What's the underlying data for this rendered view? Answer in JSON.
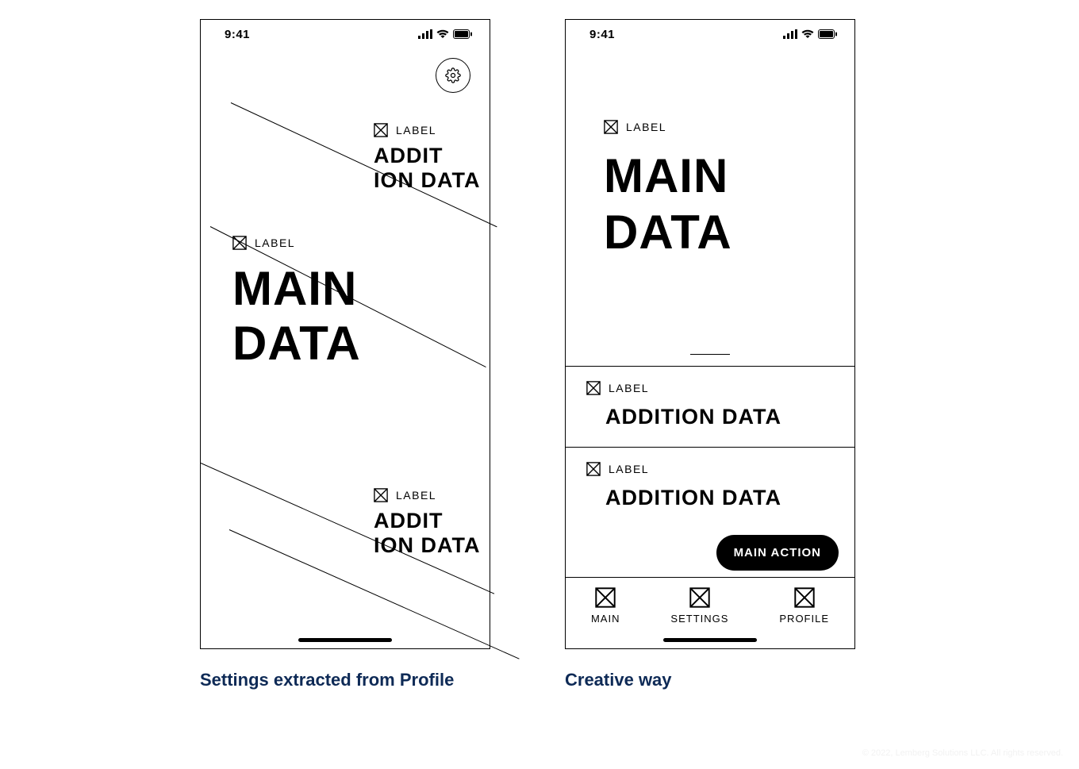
{
  "status": {
    "time": "9:41"
  },
  "left": {
    "caption": "Settings extracted from Profile",
    "top_block": {
      "label": "LABEL",
      "line1": "ADDIT",
      "line2": "ION DATA"
    },
    "main_block": {
      "label": "LABEL",
      "line1": "MAIN",
      "line2": "DATA"
    },
    "bot_block": {
      "label": "LABEL",
      "line1": "ADDIT",
      "line2": "ION DATA"
    }
  },
  "right": {
    "caption": "Creative way",
    "main_block": {
      "label": "LABEL",
      "line1": "MAIN",
      "line2": "DATA"
    },
    "card1": {
      "label": "LABEL",
      "text": "ADDITION DATA"
    },
    "card2": {
      "label": "LABEL",
      "text": "ADDITION DATA"
    },
    "fab": "MAIN ACTION",
    "tabs": {
      "main": "MAIN",
      "settings": "SETTINGS",
      "profile": "PROFILE"
    }
  },
  "footer": "© 2022, Lemberg Solutions LLC. All rights reserved."
}
